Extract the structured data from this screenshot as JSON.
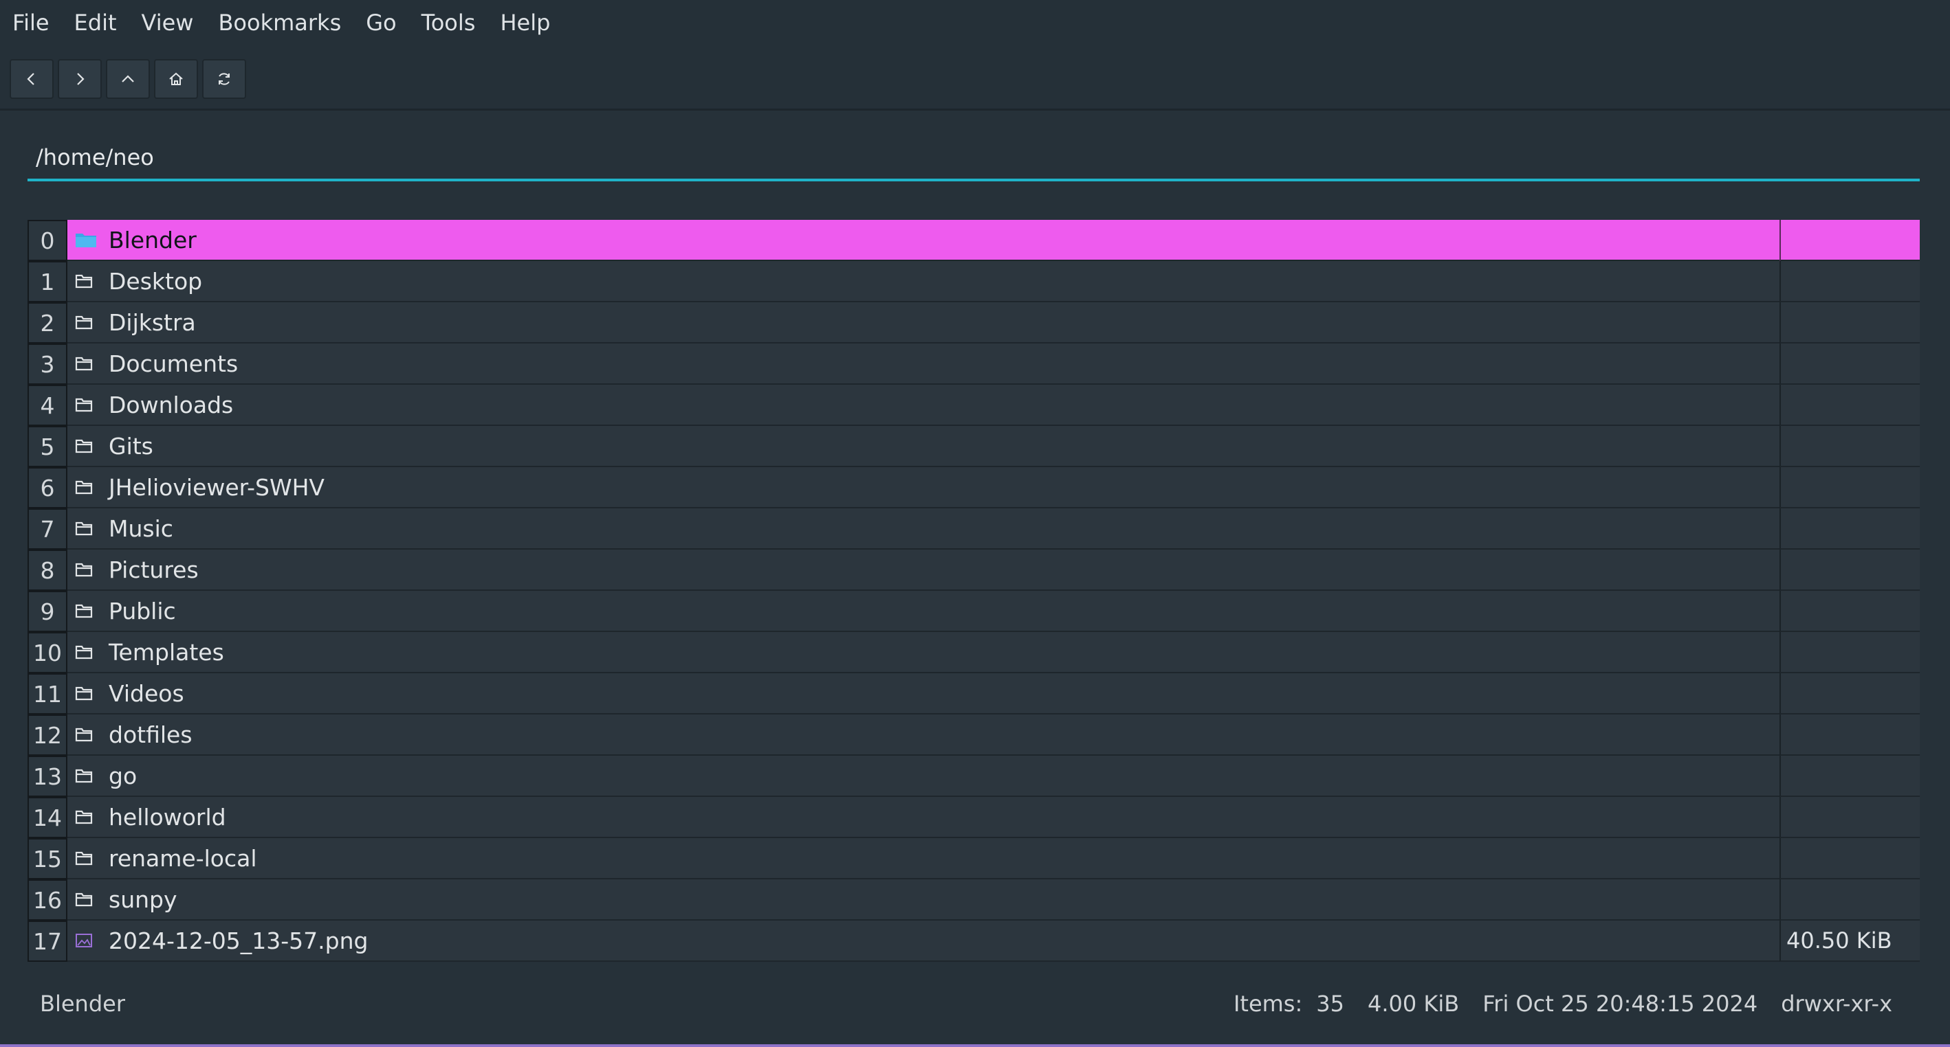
{
  "menu": [
    "File",
    "Edit",
    "View",
    "Bookmarks",
    "Go",
    "Tools",
    "Help"
  ],
  "toolbar": {
    "buttons": [
      "back-icon",
      "forward-icon",
      "up-icon",
      "home-icon",
      "refresh-icon"
    ]
  },
  "path": {
    "value": "/home/neo"
  },
  "files": [
    {
      "index": "0",
      "name": "Blender",
      "type": "folder",
      "size": "",
      "selected": true
    },
    {
      "index": "1",
      "name": "Desktop",
      "type": "folder",
      "size": ""
    },
    {
      "index": "2",
      "name": "Dijkstra",
      "type": "folder",
      "size": ""
    },
    {
      "index": "3",
      "name": "Documents",
      "type": "folder",
      "size": ""
    },
    {
      "index": "4",
      "name": "Downloads",
      "type": "folder",
      "size": ""
    },
    {
      "index": "5",
      "name": "Gits",
      "type": "folder",
      "size": ""
    },
    {
      "index": "6",
      "name": "JHelioviewer-SWHV",
      "type": "folder",
      "size": ""
    },
    {
      "index": "7",
      "name": "Music",
      "type": "folder",
      "size": ""
    },
    {
      "index": "8",
      "name": "Pictures",
      "type": "folder",
      "size": ""
    },
    {
      "index": "9",
      "name": "Public",
      "type": "folder",
      "size": ""
    },
    {
      "index": "10",
      "name": "Templates",
      "type": "folder",
      "size": ""
    },
    {
      "index": "11",
      "name": "Videos",
      "type": "folder",
      "size": ""
    },
    {
      "index": "12",
      "name": "dotfiles",
      "type": "folder",
      "size": ""
    },
    {
      "index": "13",
      "name": "go",
      "type": "folder",
      "size": ""
    },
    {
      "index": "14",
      "name": "helloworld",
      "type": "folder",
      "size": ""
    },
    {
      "index": "15",
      "name": "rename-local",
      "type": "folder",
      "size": ""
    },
    {
      "index": "16",
      "name": "sunpy",
      "type": "folder",
      "size": ""
    },
    {
      "index": "17",
      "name": "2024-12-05_13-57.png",
      "type": "image",
      "size": "40.50 KiB"
    }
  ],
  "status": {
    "selected_name": "Blender",
    "items_label": "Items:",
    "items_count": "35",
    "size": "4.00 KiB",
    "modified": "Fri Oct 25 20:48:15 2024",
    "permissions": "drwxr-xr-x"
  },
  "colors": {
    "selection": "#ee5bee",
    "accent": "#1fb3c8",
    "selected_folder_icon": "#3aa7e6",
    "image_icon": "#9a6fd6"
  }
}
